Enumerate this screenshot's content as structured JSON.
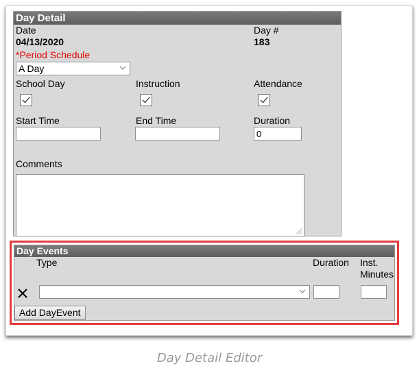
{
  "day_detail": {
    "header": "Day Detail",
    "date_label": "Date",
    "date_value": "04/13/2020",
    "day_num_label": "Day #",
    "day_num_value": "183",
    "period_schedule_label": "*Period Schedule",
    "period_schedule_value": "A Day",
    "school_day_label": "School Day",
    "instruction_label": "Instruction",
    "attendance_label": "Attendance",
    "school_day_checked": true,
    "instruction_checked": true,
    "attendance_checked": true,
    "start_time_label": "Start Time",
    "start_time_value": "",
    "end_time_label": "End Time",
    "end_time_value": "",
    "duration_label": "Duration",
    "duration_value": "0",
    "comments_label": "Comments",
    "comments_value": ""
  },
  "day_events": {
    "header": "Day Events",
    "type_label": "Type",
    "duration_label": "Duration",
    "inst_label": "Inst.",
    "minutes_label": "Minutes",
    "type_value": "",
    "duration_value": "",
    "minutes_value": "",
    "add_button_label": "Add DayEvent",
    "delete_icon": "x-delete-icon"
  },
  "caption": "Day Detail Editor",
  "colors": {
    "header_bg": "#6b6b6b",
    "panel_bg": "#d9d9d9",
    "required_text": "#e00000",
    "highlight_border": "#e23b3b",
    "caption_text": "#9a9a9a"
  }
}
